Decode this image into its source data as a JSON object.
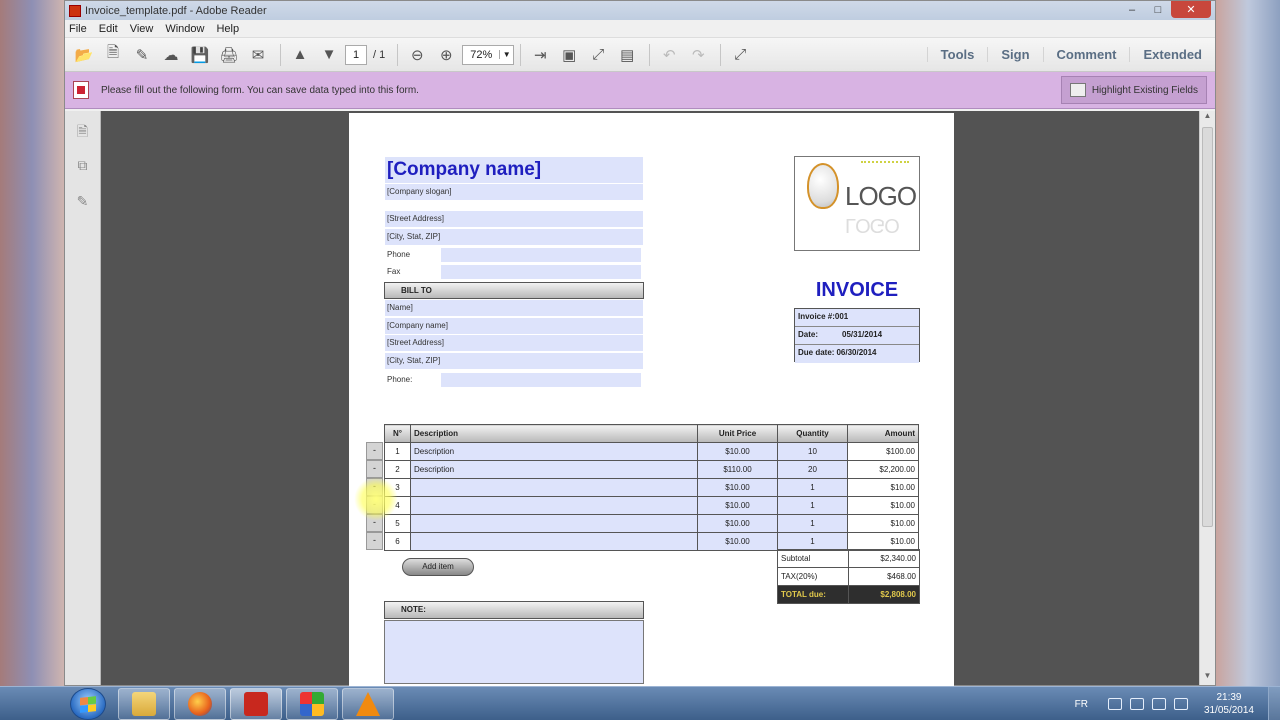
{
  "window": {
    "title": "Invoice_template.pdf - Adobe Reader",
    "controls": [
      "–",
      "□",
      "✕"
    ]
  },
  "menu": [
    "File",
    "Edit",
    "View",
    "Window",
    "Help"
  ],
  "toolbar": {
    "current_page": "1",
    "page_total": "/ 1",
    "zoom": "72%",
    "right_links": [
      "Tools",
      "Sign",
      "Comment",
      "Extended"
    ]
  },
  "formbar": {
    "message": "Please fill out the following form. You can save data typed into this form.",
    "highlight_button": "Highlight Existing Fields"
  },
  "invoice": {
    "company_name": "[Company name]",
    "company_slogan": "[Company slogan]",
    "street": "[Street Address]",
    "city": "[City, Stat, ZIP]",
    "phone_label": "Phone",
    "fax_label": "Fax",
    "bill_to_label": "BILL TO",
    "bill_name": "[Name]",
    "bill_company": "[Company name]",
    "bill_street": "[Street Address]",
    "bill_city": "[City, Stat, ZIP]",
    "bill_phone_label": "Phone:",
    "logo_text": "LOGO",
    "title": "INVOICE",
    "invoice_no_label": "Invoice #:",
    "invoice_no": "001",
    "date_label": "Date:",
    "date": "05/31/2014",
    "due_label": "Due date:",
    "due_date": "06/30/2014",
    "columns": [
      "N°",
      "Description",
      "Unit Price",
      "Quantity",
      "Amount"
    ],
    "rows": [
      {
        "n": "1",
        "desc": "Description",
        "price": "$10.00",
        "qty": "10",
        "amount": "$100.00"
      },
      {
        "n": "2",
        "desc": "Description",
        "price": "$110.00",
        "qty": "20",
        "amount": "$2,200.00"
      },
      {
        "n": "3",
        "desc": "",
        "price": "$10.00",
        "qty": "1",
        "amount": "$10.00"
      },
      {
        "n": "4",
        "desc": "",
        "price": "$10.00",
        "qty": "1",
        "amount": "$10.00"
      },
      {
        "n": "5",
        "desc": "",
        "price": "$10.00",
        "qty": "1",
        "amount": "$10.00"
      },
      {
        "n": "6",
        "desc": "",
        "price": "$10.00",
        "qty": "1",
        "amount": "$10.00"
      }
    ],
    "minus": "-",
    "subtotal_label": "Subtotal",
    "subtotal": "$2,340.00",
    "tax_label": "TAX(20%)",
    "tax": "$468.00",
    "total_label": "TOTAL due:",
    "total": "$2,808.00",
    "add_item": "Add item",
    "note_label": "NOTE:"
  },
  "taskbar": {
    "lang": "FR",
    "time": "21:39",
    "date": "31/05/2014"
  },
  "colors": {
    "field": "#dde3fb",
    "accent": "#1f1fbf",
    "formbar": "#d8b3e3"
  }
}
